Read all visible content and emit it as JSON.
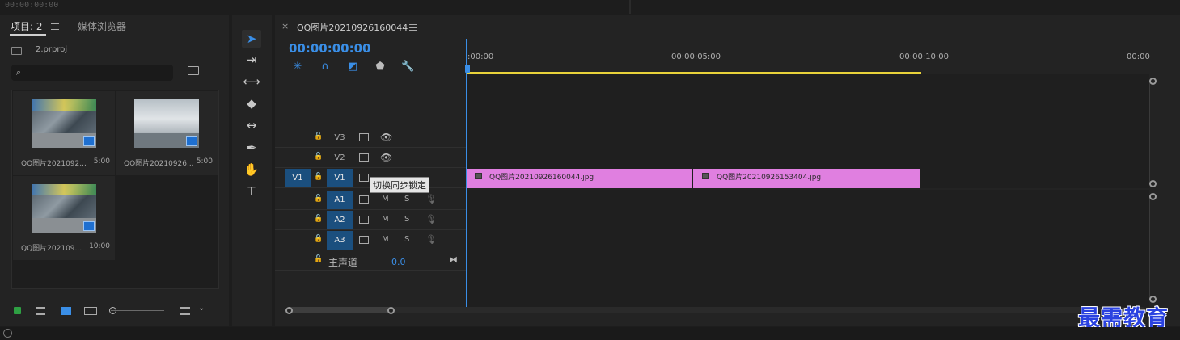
{
  "top_strip": {
    "timecode": "00:00:00:00"
  },
  "project_panel": {
    "tab_project": "项目: 2",
    "tab_media_browser": "媒体浏览器",
    "project_file": "2.prproj",
    "search_placeholder": "",
    "clips": [
      {
        "name": "QQ图片2021092...",
        "duration": "5:00"
      },
      {
        "name": "QQ图片20210926...",
        "duration": "5:00"
      },
      {
        "name": "QQ图片202109...",
        "duration": "10:00"
      }
    ]
  },
  "tools": {
    "items": [
      "selection-tool",
      "track-select-tool",
      "ripple-edit-tool",
      "razor-tool",
      "slip-tool",
      "pen-tool",
      "hand-tool",
      "type-tool"
    ]
  },
  "timeline": {
    "sequence_name": "QQ图片20210926160044",
    "timecode": "00:00:00:00",
    "ruler": [
      ":00:00",
      "00:00:05:00",
      "00:00:10:00",
      "00:00"
    ],
    "tracks": {
      "V3": "V3",
      "V2": "V2",
      "V1": "V1",
      "V1_source": "V1",
      "A1": "A1",
      "A2": "A2",
      "A3": "A3",
      "mute": "M",
      "solo": "S"
    },
    "master_label": "主声道",
    "master_value": "0.0",
    "tooltip": "切换同步锁定",
    "clips_v1": [
      {
        "label": "QQ图片20210926160044.jpg"
      },
      {
        "label": "QQ图片20210926153404.jpg"
      }
    ],
    "accent_color": "#3a8ee6",
    "clip_color": "#e07fe0",
    "work_area_color": "#e8d23a"
  },
  "watermark": "最需教育"
}
